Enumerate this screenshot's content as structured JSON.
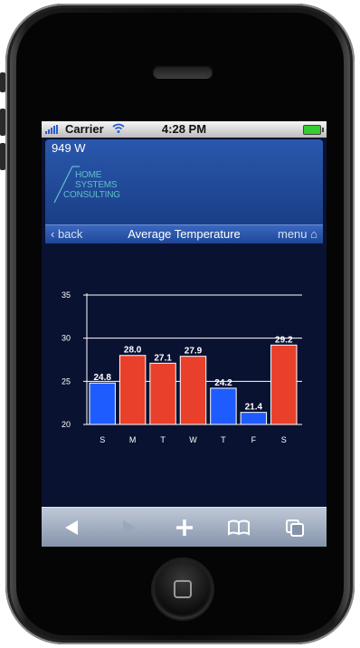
{
  "status_bar": {
    "carrier": "Carrier",
    "time": "4:28 PM"
  },
  "header": {
    "power_reading": "949 W",
    "logo_lines": [
      "HOME",
      "SYSTEMS",
      "CONSULTING"
    ]
  },
  "nav": {
    "back_label": "back",
    "title": "Average Temperature",
    "menu_label": "menu"
  },
  "chart_data": {
    "type": "bar",
    "categories": [
      "S",
      "M",
      "T",
      "W",
      "T",
      "F",
      "S"
    ],
    "values": [
      24.8,
      28.0,
      27.1,
      27.9,
      24.2,
      21.4,
      29.2
    ],
    "value_labels": [
      "24.8",
      "28.0",
      "27.1",
      "27.9",
      "24.2",
      "21.4",
      "29.2"
    ],
    "bar_colors": [
      "#1e5cff",
      "#e8402a",
      "#e8402a",
      "#e8402a",
      "#1e5cff",
      "#1e5cff",
      "#e8402a"
    ],
    "y_ticks": [
      20,
      25,
      30,
      35
    ],
    "ylim": [
      20,
      35
    ],
    "grid": true,
    "title": "",
    "xlabel": "",
    "ylabel": ""
  },
  "toolbar": {
    "icons": [
      "back-arrow-icon",
      "forward-arrow-icon",
      "plus-icon",
      "bookmarks-icon",
      "pages-icon"
    ]
  },
  "colors": {
    "screen_bg": "#0a1232",
    "header_blue": "#1e4796",
    "cold": "#1e5cff",
    "warm": "#e8402a"
  }
}
